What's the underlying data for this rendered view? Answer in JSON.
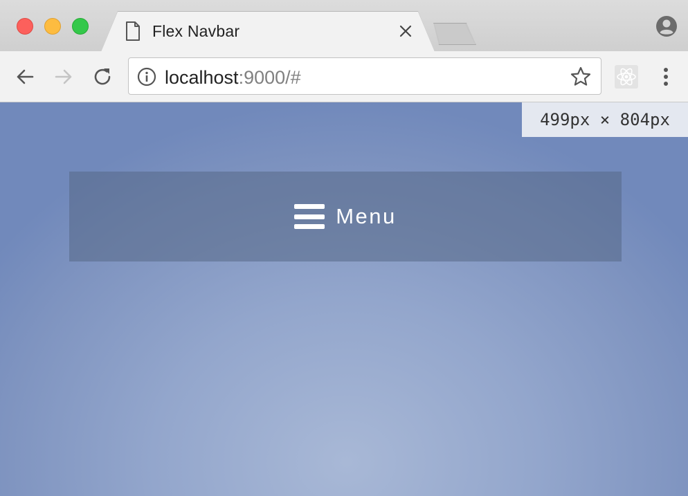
{
  "tab": {
    "title": "Flex Navbar"
  },
  "address_bar": {
    "host": "localhost",
    "rest": ":9000/#"
  },
  "viewport": {
    "dimension_badge": "499px × 804px",
    "navbar": {
      "menu_label": "Menu"
    }
  },
  "icons": {
    "tab": "page-icon",
    "tab_close": "close-icon",
    "profile": "profile-icon",
    "back": "back-arrow-icon",
    "forward": "forward-arrow-icon",
    "reload": "reload-icon",
    "site_info": "info-icon",
    "bookmark": "star-icon",
    "extension": "react-icon",
    "browser_menu": "kebab-menu-icon",
    "menu": "hamburger-icon"
  },
  "colors": {
    "traffic_close": "#fc605c",
    "traffic_minimize": "#fdbc40",
    "traffic_maximize": "#34c84a",
    "background_center": "#a8b8d6",
    "background_edge": "#7189bb",
    "navbar_text": "#ffffff",
    "url_muted": "#808080"
  }
}
